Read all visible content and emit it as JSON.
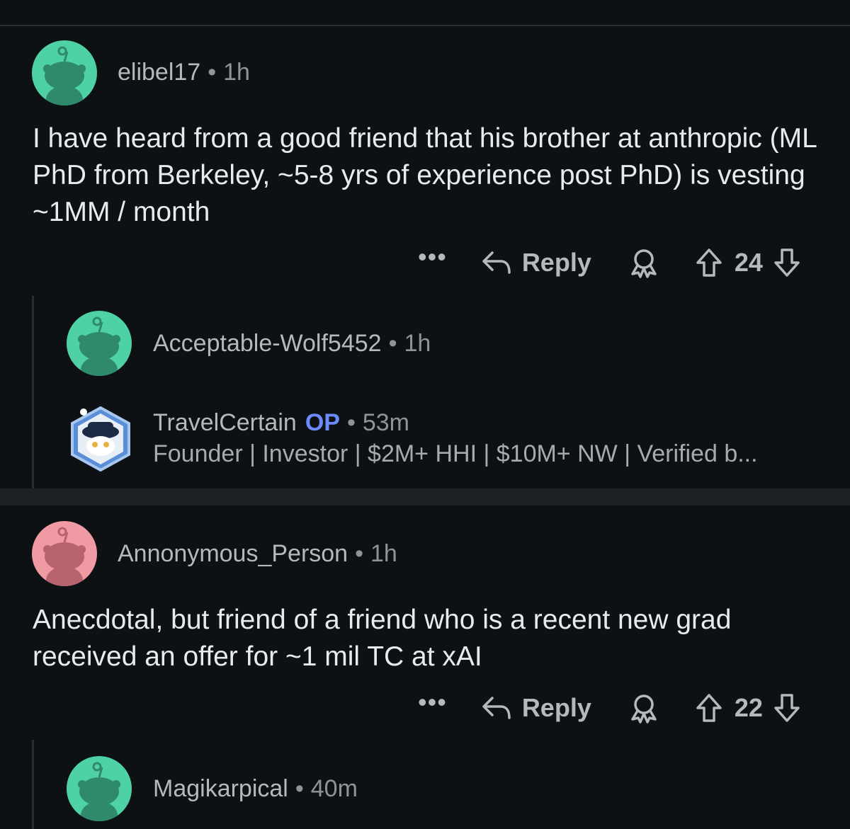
{
  "comments": [
    {
      "username": "elibel17",
      "time": "1h",
      "body": "I have heard from a good friend that his brother at anthropic (ML PhD from Berkeley, ~5-8 yrs of experience post PhD) is vesting ~1MM / month",
      "more": "•••",
      "reply_label": "Reply",
      "votes": "24",
      "avatar_color": "#4fd1a6",
      "replies": [
        {
          "username": "Acceptable-Wolf5452",
          "time": "1h",
          "avatar_color": "#4fd1a6"
        },
        {
          "username": "TravelCertain",
          "op_tag": "OP",
          "time": "53m",
          "flair": "Founder | Investor | $2M+ HHI | $10M+ NW | Verified b..."
        }
      ]
    },
    {
      "username": "Annonymous_Person",
      "time": "1h",
      "body": "Anecdotal, but friend of a friend who is a recent new grad received an offer for ~1 mil TC at xAI",
      "more": "•••",
      "reply_label": "Reply",
      "votes": "22",
      "avatar_color": "#f09aa3",
      "replies": [
        {
          "username": "Magikarpical",
          "time": "40m",
          "avatar_color": "#4fd1a6"
        }
      ]
    }
  ],
  "separator_dot": "•",
  "icons": [
    "more-icon",
    "reply-icon",
    "award-icon",
    "upvote-icon",
    "downvote-icon",
    "avatar-snoo-icon"
  ]
}
